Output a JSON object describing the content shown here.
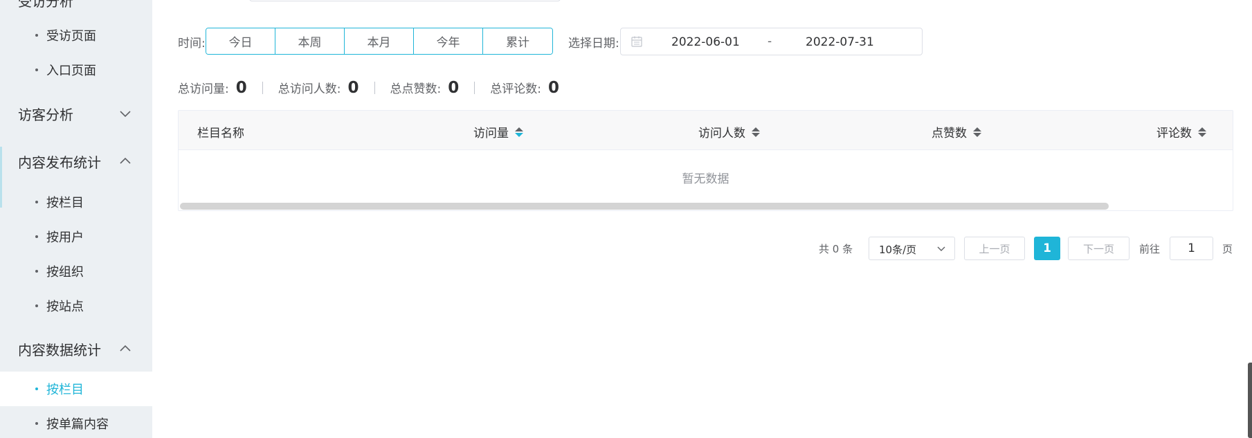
{
  "sidebar": {
    "top_partial_label": "受访分析",
    "items_top": [
      {
        "label": "受访页面"
      },
      {
        "label": "入口页面"
      }
    ],
    "group_visitor": {
      "label": "访客分析"
    },
    "group_content_publish": {
      "label": "内容发布统计"
    },
    "publish_items": [
      {
        "label": "按栏目"
      },
      {
        "label": "按用户"
      },
      {
        "label": "按组织"
      },
      {
        "label": "按站点"
      }
    ],
    "group_content_data": {
      "label": "内容数据统计"
    },
    "data_items": [
      {
        "label": "按栏目"
      },
      {
        "label": "按单篇内容"
      }
    ]
  },
  "filter": {
    "time_label": "时间:",
    "time_buttons": [
      "今日",
      "本周",
      "本月",
      "今年",
      "累计"
    ],
    "date_label": "选择日期:",
    "date_start": "2022-06-01",
    "date_separator": "-",
    "date_end": "2022-07-31"
  },
  "stats": [
    {
      "label": "总访问量:",
      "value": "0"
    },
    {
      "label": "总访问人数:",
      "value": "0"
    },
    {
      "label": "总点赞数:",
      "value": "0"
    },
    {
      "label": "总评论数:",
      "value": "0"
    }
  ],
  "table": {
    "columns": [
      "栏目名称",
      "访问量",
      "访问人数",
      "点赞数",
      "评论数"
    ],
    "empty_text": "暂无数据"
  },
  "pagination": {
    "total_text": "共 0 条",
    "page_size": "10条/页",
    "prev": "上一页",
    "current": "1",
    "next": "下一页",
    "goto_label": "前往",
    "goto_value": "1",
    "page_unit": "页"
  },
  "colors": {
    "accent": "#1fb5d8",
    "sidebar_bg": "#ecf0f3"
  }
}
